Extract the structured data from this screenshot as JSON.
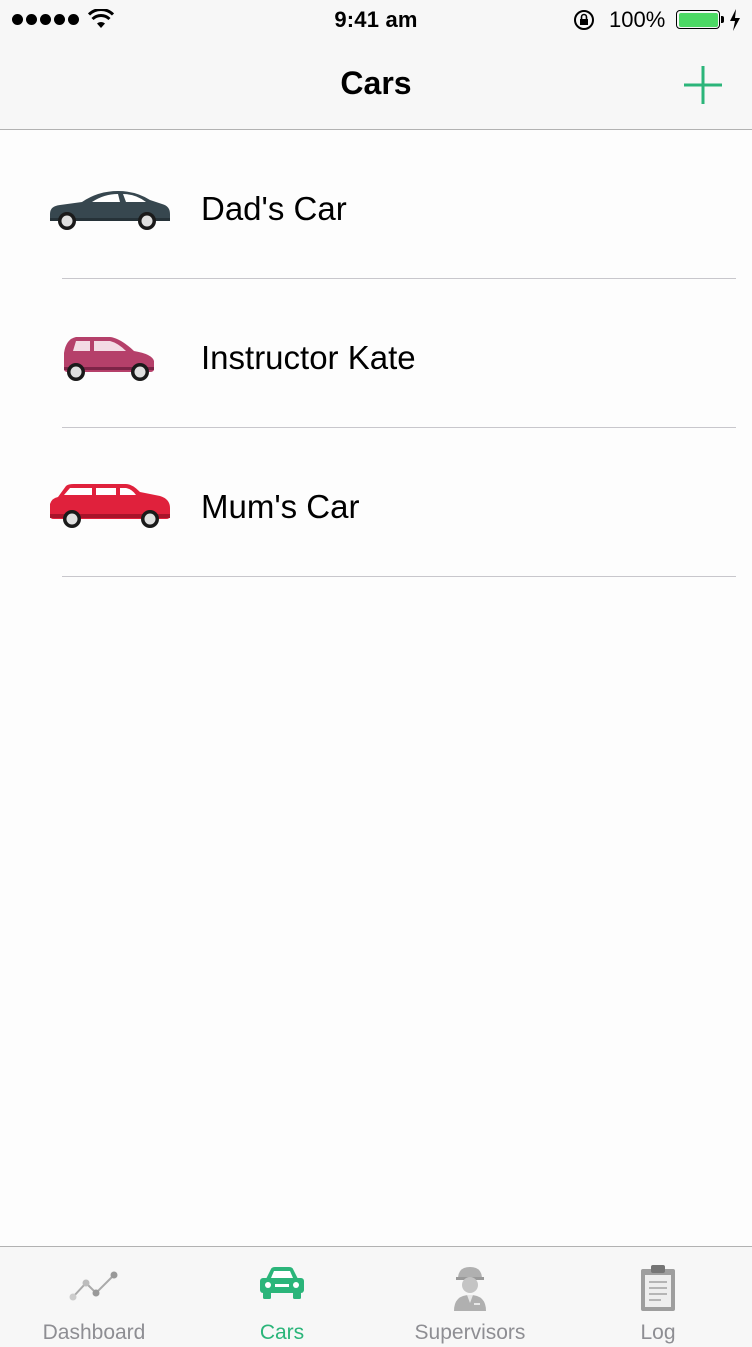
{
  "status_bar": {
    "time": "9:41 am",
    "battery_percent": "100%",
    "battery_level": 1.0,
    "signal_bars": 5
  },
  "nav": {
    "title": "Cars",
    "add_icon": "plus-icon"
  },
  "cars": [
    {
      "name": "Dad's Car",
      "icon": "sedan-icon",
      "color": "#37474f"
    },
    {
      "name": "Instructor Kate",
      "icon": "compact-car-icon",
      "color": "#b5406a"
    },
    {
      "name": "Mum's Car",
      "icon": "station-wagon-icon",
      "color": "#e0213c"
    }
  ],
  "tabs": [
    {
      "label": "Dashboard",
      "icon": "line-chart-icon",
      "active": false
    },
    {
      "label": "Cars",
      "icon": "car-icon",
      "active": true
    },
    {
      "label": "Supervisors",
      "icon": "person-hardhat-icon",
      "active": false
    },
    {
      "label": "Log",
      "icon": "clipboard-icon",
      "active": false
    }
  ],
  "colors": {
    "accent": "#2bb57a",
    "inactive_tab": "#8e8e93",
    "battery_fill": "#4cd964"
  }
}
